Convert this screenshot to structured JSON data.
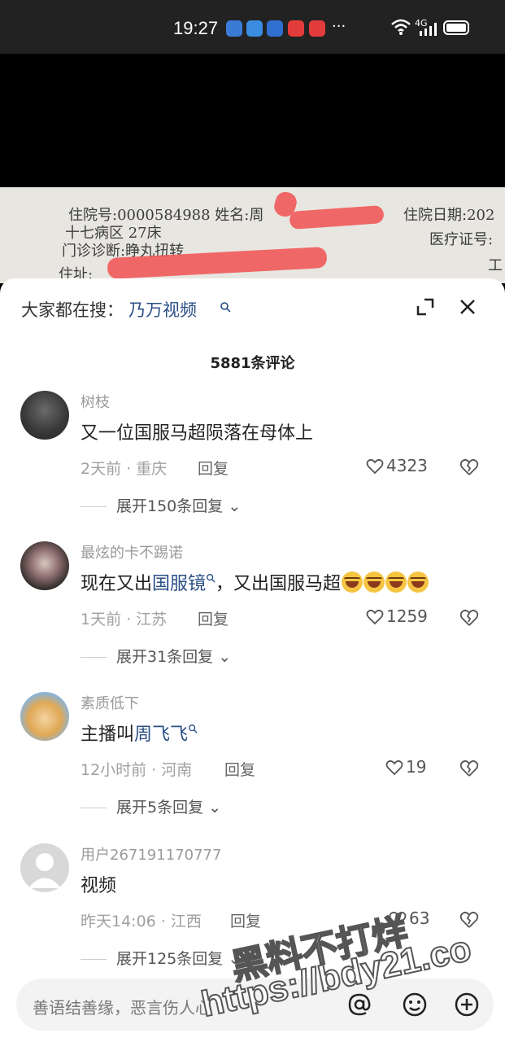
{
  "status_bar": {
    "time": "19:27",
    "more": "···",
    "network": "4G"
  },
  "video": {
    "doc_lines": [
      "住院号:0000584988  姓名:周",
      "十七病区          27床",
      "门诊诊断:睁丸扭转",
      "住址:",
      "住院日期:202",
      "医疗证号:",
      "工"
    ]
  },
  "sheet": {
    "search_label": "大家都在搜：",
    "search_term": "乃万视频",
    "comment_count": "5881条评论",
    "reply_label": "回复"
  },
  "comments": [
    {
      "user": "树枝",
      "text": "又一位国服马超陨落在母体上",
      "meta": "2天前 · 重庆",
      "likes": "4323",
      "expand": "展开150条回复"
    },
    {
      "user": "最炫的卡不踢诺",
      "text_a": "现在又出",
      "text_link": "国服镜",
      "text_b": "，又出国服马超",
      "meta": "1天前 · 江苏",
      "likes": "1259",
      "expand": "展开31条回复"
    },
    {
      "user": "素质低下",
      "text_a": "主播叫",
      "text_link": "周飞飞",
      "meta": "12小时前 · 河南",
      "likes": "19",
      "expand": "展开5条回复"
    },
    {
      "user": "用户267191170777",
      "text": "视频",
      "meta": "昨天14:06 · 江西",
      "likes": "63",
      "expand": "展开125条回复"
    }
  ],
  "input": {
    "placeholder": "善语结善缘，恶言伤人心"
  },
  "watermark": {
    "line1": "黑料不打烊",
    "line2": "https://bdy21.co"
  },
  "colors": {
    "link": "#2a4f86",
    "redaction": "#f05a5a"
  }
}
